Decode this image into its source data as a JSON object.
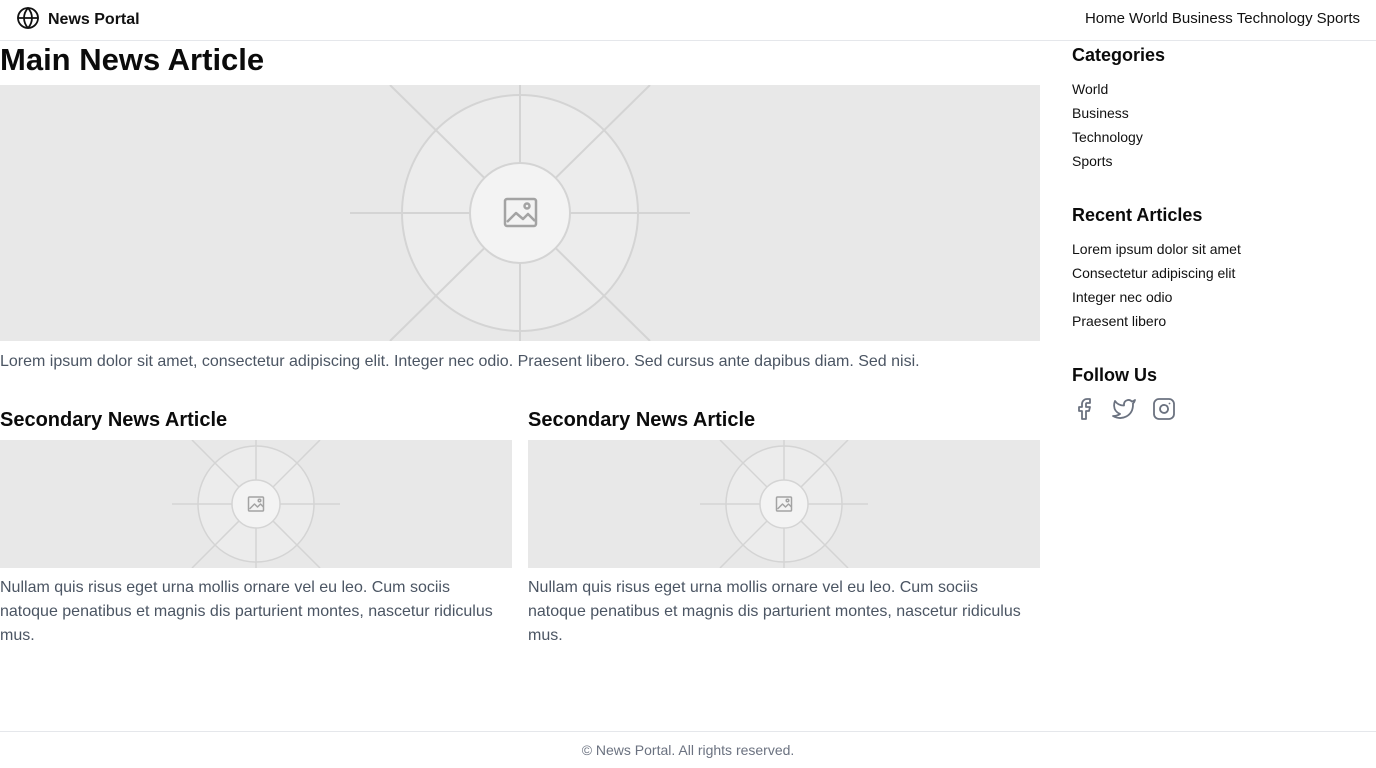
{
  "header": {
    "brand": "News Portal",
    "logo_icon": "globe-icon",
    "nav": [
      "Home",
      "World",
      "Business",
      "Technology",
      "Sports"
    ]
  },
  "main_article": {
    "title": "Main News Article",
    "image_icon": "image-placeholder-icon",
    "summary": "Lorem ipsum dolor sit amet, consectetur adipiscing elit. Integer nec odio. Praesent libero. Sed cursus ante dapibus diam. Sed nisi."
  },
  "secondary_articles": [
    {
      "title": "Secondary News Article",
      "summary": "Nullam quis risus eget urna mollis ornare vel eu leo. Cum sociis natoque penatibus et magnis dis parturient montes, nascetur ridiculus mus."
    },
    {
      "title": "Secondary News Article",
      "summary": "Nullam quis risus eget urna mollis ornare vel eu leo. Cum sociis natoque penatibus et magnis dis parturient montes, nascetur ridiculus mus."
    }
  ],
  "sidebar": {
    "categories": {
      "heading": "Categories",
      "items": [
        "World",
        "Business",
        "Technology",
        "Sports"
      ]
    },
    "recent": {
      "heading": "Recent Articles",
      "items": [
        "Lorem ipsum dolor sit amet",
        "Consectetur adipiscing elit",
        "Integer nec odio",
        "Praesent libero"
      ]
    },
    "follow": {
      "heading": "Follow Us",
      "icons": [
        "facebook-icon",
        "twitter-icon",
        "instagram-icon"
      ]
    }
  },
  "footer": {
    "text": "© News Portal. All rights reserved."
  },
  "colors": {
    "text": "#111827",
    "muted": "#4b5563",
    "placeholder_bg": "#e8e8e8",
    "border": "#e5e7eb",
    "icon": "#6b7280"
  }
}
